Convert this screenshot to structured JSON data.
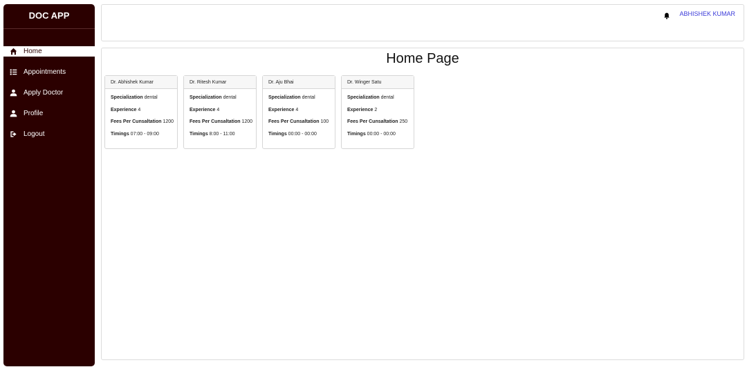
{
  "sidebar": {
    "logo": "DOC APP",
    "items": [
      {
        "label": "Home",
        "icon": "home-icon",
        "active": true
      },
      {
        "label": "Appointments",
        "icon": "list-icon",
        "active": false
      },
      {
        "label": "Apply Doctor",
        "icon": "user-icon",
        "active": false
      },
      {
        "label": "Profile",
        "icon": "user-icon",
        "active": false
      },
      {
        "label": "Logout",
        "icon": "logout-icon",
        "active": false
      }
    ]
  },
  "header": {
    "user_name": "ABHISHEK KUMAR"
  },
  "main": {
    "title": "Home Page",
    "labels": {
      "specialization": "Specialization",
      "experience": "Experience",
      "fees": "Fees Per Cunsaltation",
      "timings": "Timings"
    },
    "doctors": [
      {
        "name": "Dr. Abhishek Kumar",
        "specialization": "dental",
        "experience": "4",
        "fees": "1200",
        "timings": "07:00 - 09:00"
      },
      {
        "name": "Dr. Ritesh Kumar",
        "specialization": "dental",
        "experience": "4",
        "fees": "1200",
        "timings": "8:00 - 11:00"
      },
      {
        "name": "Dr. Aju Bhai",
        "specialization": "dental",
        "experience": "4",
        "fees": "100",
        "timings": "00:00 - 00:00"
      },
      {
        "name": "Dr. Winger Satu",
        "specialization": "dental",
        "experience": "2",
        "fees": "250",
        "timings": "00:00 - 00:00"
      }
    ]
  },
  "colors": {
    "sidebar_bg": "#2b0000",
    "link": "#3b3bd9"
  }
}
